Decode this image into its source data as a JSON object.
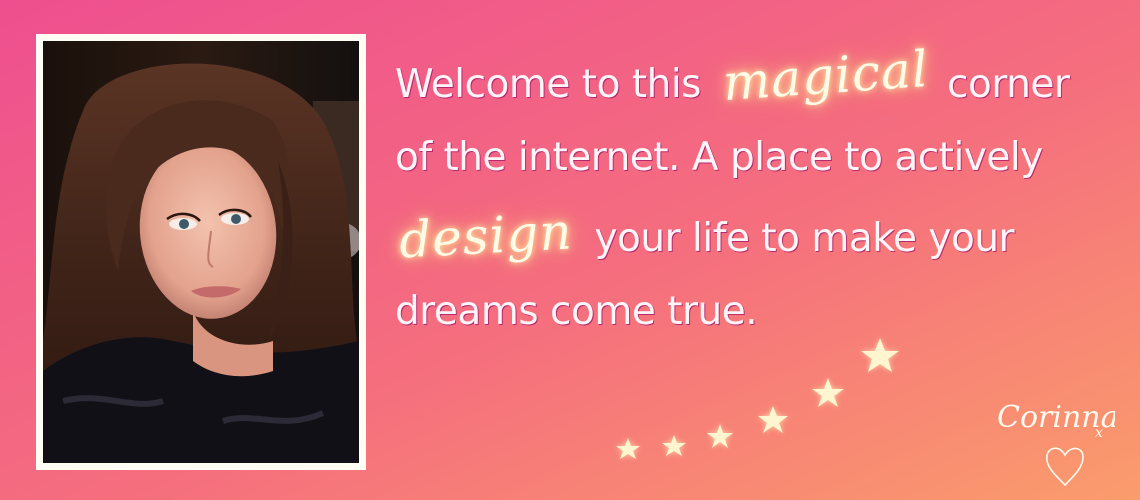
{
  "banner": {
    "background_start": "#f0528e",
    "background_end": "#f99a70",
    "text_color": "#fff4f7",
    "glow_color": "#ffe9a8",
    "message": {
      "line1_before": "Welcome to this",
      "line1_script": "magical",
      "line1_after": "corner",
      "line2": "of the internet. A place to actively",
      "line3_script": "design",
      "line3_after": "your life to make your",
      "line4": "dreams come true."
    },
    "stars": {
      "count": 6,
      "color": "#fff6cf"
    },
    "signature": {
      "name": "Corinna",
      "suffix": "x",
      "heart_icon": "heart-icon"
    },
    "photo": {
      "frame_color": "#fffdf4",
      "description_icon": "portrait-photo"
    }
  }
}
